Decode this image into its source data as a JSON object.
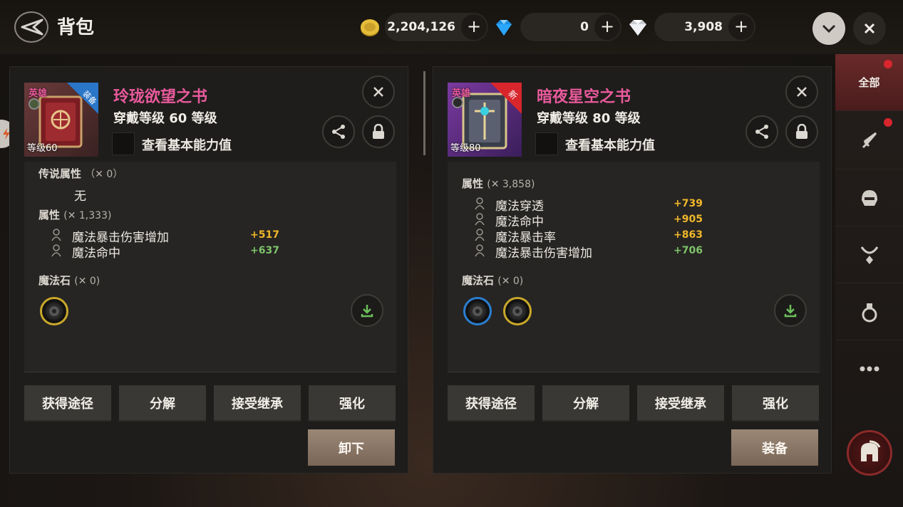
{
  "header": {
    "title": "背包",
    "gold_amount": "2,204,126",
    "blue_gem_amount": "0",
    "diamond_amount": "3,908",
    "plus_label": "+"
  },
  "panels": [
    {
      "item_name": "玲珑欲望之书",
      "item_name_color": "#e95a9c",
      "grade": "英雄",
      "corner_tag": "装备",
      "level_tag": "等级60",
      "requirement": "穿戴等级 60 等级",
      "view_basic_label": "查看基本能力值",
      "legend_section": {
        "label": "传说属性",
        "count": "（✕ 0）",
        "empty_text": "无"
      },
      "attr_section": {
        "label": "属性",
        "count": "(✕ 1,333)"
      },
      "stats": [
        {
          "name": "魔法暴击伤害增加",
          "value": "+517",
          "color": "gold"
        },
        {
          "name": "魔法命中",
          "value": "+637",
          "color": "green"
        }
      ],
      "stone_section": {
        "label": "魔法石",
        "count": "(✕ 0)"
      },
      "stones": [
        "yellow"
      ],
      "buttons": [
        "获得途径",
        "分解",
        "接受继承",
        "强化"
      ],
      "main_button": "卸下"
    },
    {
      "item_name": "暗夜星空之书",
      "item_name_color": "#e95a9c",
      "grade": "英雄",
      "corner_tag": "新",
      "level_tag": "等级80",
      "requirement": "穿戴等级 80 等级",
      "view_basic_label": "查看基本能力值",
      "attr_section": {
        "label": "属性",
        "count": "(✕ 3,858)"
      },
      "stats": [
        {
          "name": "魔法穿透",
          "value": "+739",
          "color": "gold"
        },
        {
          "name": "魔法命中",
          "value": "+905",
          "color": "gold"
        },
        {
          "name": "魔法暴击率",
          "value": "+863",
          "color": "gold"
        },
        {
          "name": "魔法暴击伤害增加",
          "value": "+706",
          "color": "green"
        }
      ],
      "stone_section": {
        "label": "魔法石",
        "count": "(✕ 0)"
      },
      "stones": [
        "blue",
        "yellow"
      ],
      "buttons": [
        "获得途径",
        "分解",
        "接受继承",
        "强化"
      ],
      "main_button": "装备"
    }
  ],
  "rail": {
    "all_label": "全部",
    "items": [
      "sword-icon",
      "helmet-icon",
      "necklace-icon",
      "potion-icon",
      "more-icon"
    ]
  }
}
